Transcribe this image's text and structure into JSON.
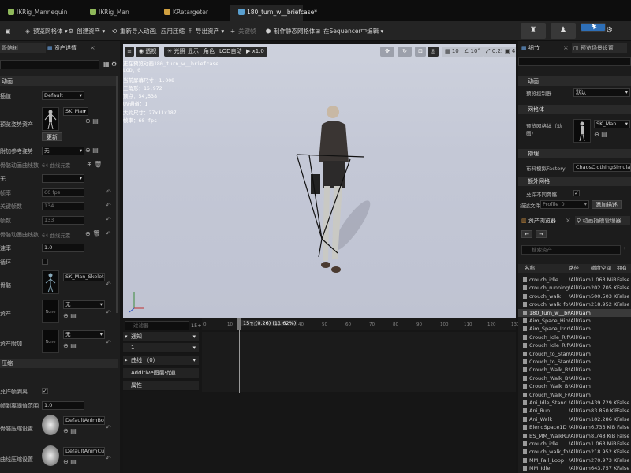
{
  "tabs": [
    {
      "label": "IKRig_Mannequin",
      "color": "#8fb85a"
    },
    {
      "label": "IKRig_Man",
      "color": "#8fb85a"
    },
    {
      "label": "KRetargeter",
      "color": "#d0a040"
    },
    {
      "label": "180_turn_w__briefcase*",
      "color": "#5aa0d0"
    }
  ],
  "toolbar": {
    "preview_mesh": "预览网格体",
    "create_asset": "创建资产",
    "reimport": "重新导入动画",
    "apply_compress": "应用压缩",
    "export_asset": "导出资产",
    "key": "关键帧",
    "make_static_mesh": "制作静态网格体",
    "edit_in_sequencer": "在Sequencer中编辑"
  },
  "left": {
    "tab_skeleton": "骨骼树",
    "tab_asset_details": "资产详情",
    "search_placeholder": "搜索",
    "header_anim": "动画",
    "rows": {
      "interp": "插值",
      "interp_val": "Default",
      "preview_mesh": "预览姿势资产",
      "preview_val": "SK_Man",
      "update": "更新",
      "ref_pose": "附加参考姿势",
      "ref_val": "无",
      "frame_rate": "帧率",
      "frame_rate_val": "60 fps",
      "keys": "关键帧数",
      "keys_val": "134",
      "frames": "帧数",
      "frames_val": "133",
      "curve_count": "骨骼动画曲线数",
      "curve_val": "64 曲线元素",
      "rate": "速率",
      "rate_val": "1.0",
      "loop": "循环",
      "skeleton": "骨骼",
      "skeleton_val": "SK_Man_Skeleton",
      "asset": "资产",
      "asset_val": "无",
      "asset_thumb": "None",
      "asset2": "资产附加",
      "asset2_val": "无",
      "asset2_thumb": "None",
      "section": "压缩",
      "allow_frame": "允许帧剥离",
      "frame_threshold": "帧剥离阈值范围",
      "frame_threshold_val": "1.0",
      "bone_codec": "骨骼压缩设置",
      "bone_codec_val": "DefaultAnimBone",
      "curve_codec": "曲线压缩设置",
      "curve_codec_val": "DefaultAnimCurv"
    }
  },
  "viewport": {
    "perspective": "透视",
    "lit": "光照",
    "show": "显示",
    "role": "角色",
    "lod": "LOD自动",
    "speed": "x1.0",
    "snap1": "10",
    "snap2": "10°",
    "snap3": "0.25",
    "snap4": "4",
    "stats": [
      "正在预览动画180_turn_w__briefcase",
      "LOD：0",
      "当前屏幕尺寸：1.008",
      "三角形：16,972",
      "顶点：54,538",
      "UV通道：1",
      "大约尺寸：27x11x187",
      "帧率：60 fps"
    ]
  },
  "timeline": {
    "filter_placeholder": "过滤器",
    "frame_count": "15+",
    "playhead": "15+ (0.26) (11.62%)",
    "tracks": [
      "通知",
      "1",
      "曲线 （0）",
      "Additive图层轨道",
      "属性"
    ],
    "ticks": [
      "0",
      "10",
      "20",
      "30",
      "40",
      "50",
      "60",
      "70",
      "80",
      "90",
      "100",
      "110",
      "120",
      "130"
    ]
  },
  "right": {
    "tab_details": "细节",
    "tab_preview": "预览场景设置",
    "sec_anim": "动画",
    "preview_controller": "预览控制器",
    "preview_controller_val": "默认",
    "sec_mesh": "网格体",
    "preview_mesh": "预览网格体（动画）",
    "preview_mesh_val": "SK_Man",
    "sec_physics": "物理",
    "cloth_factory": "布料模拟Factory",
    "cloth_val": "ChaosClothingSimulation",
    "sec_extra": "额外网格",
    "allow_diff": "允许不同骨骼",
    "profile_label": "描述文件",
    "profile_val": "Profile_0",
    "add_profile": "添加描述",
    "tab_browser": "资产浏览器",
    "tab_anim_mgr": "动画插槽管理器",
    "search_placeholder": "搜索资产",
    "columns": [
      "名称",
      "路径",
      "磁盘空间",
      "拥有"
    ],
    "items": [
      [
        "crouch_idle",
        "/All/Game",
        "1.063 MiB",
        "False"
      ],
      [
        "crouch_running",
        "/All/Game",
        "202.705 KiB",
        "False"
      ],
      [
        "crouch_walk",
        "/All/Game",
        "500.503 KiB",
        "False"
      ],
      [
        "crouch_walk_forw",
        "/All/Game",
        "218.952 KiB",
        "False"
      ],
      [
        "180_turn_w__brie",
        "/All/Game",
        "",
        ""
      ],
      [
        "Aim_Space_Hip",
        "/All/Game",
        "",
        ""
      ],
      [
        "Aim_Space_Irons",
        "/All/Game",
        "",
        ""
      ],
      [
        "Crouch_Idle_Rifle",
        "/All/Game",
        "",
        ""
      ],
      [
        "Crouch_Idle_Rifle",
        "/All/Game",
        "",
        ""
      ],
      [
        "Crouch_to_Stand",
        "/All/Game",
        "",
        ""
      ],
      [
        "Crouch_to_Stand",
        "/All/Game",
        "",
        ""
      ],
      [
        "Crouch_Walk_Bwd",
        "/All/Game",
        "",
        ""
      ],
      [
        "Crouch_Walk_Bwd",
        "/All/Game",
        "",
        ""
      ],
      [
        "Crouch_Walk_Bwd",
        "/All/Game",
        "",
        ""
      ],
      [
        "Crouch_Walk_Fwd",
        "/All/Game",
        "",
        ""
      ],
      [
        "Ani_Idle_Stand",
        "/All/Game",
        "439.729 KiB",
        "False"
      ],
      [
        "Ani_Run",
        "/All/Game",
        "83.850 KiB",
        "False"
      ],
      [
        "Ani_Walk",
        "/All/Game",
        "102.286 KiB",
        "False"
      ],
      [
        "BlendSpace1D_Cr",
        "/All/Game",
        "6.733 KiB",
        "False"
      ],
      [
        "BS_MM_WalkRun",
        "/All/Game",
        "8.748 KiB",
        "False"
      ],
      [
        "crouch_idle",
        "/All/Game",
        "1.063 MiB",
        "False"
      ],
      [
        "crouch_walk_forw",
        "/All/Game",
        "218.952 KiB",
        "False"
      ],
      [
        "MM_Fall_Loop",
        "/All/Game",
        "270.973 KiB",
        "False"
      ],
      [
        "MM_Idle",
        "/All/Game",
        "643.757 KiB",
        "False"
      ]
    ]
  }
}
